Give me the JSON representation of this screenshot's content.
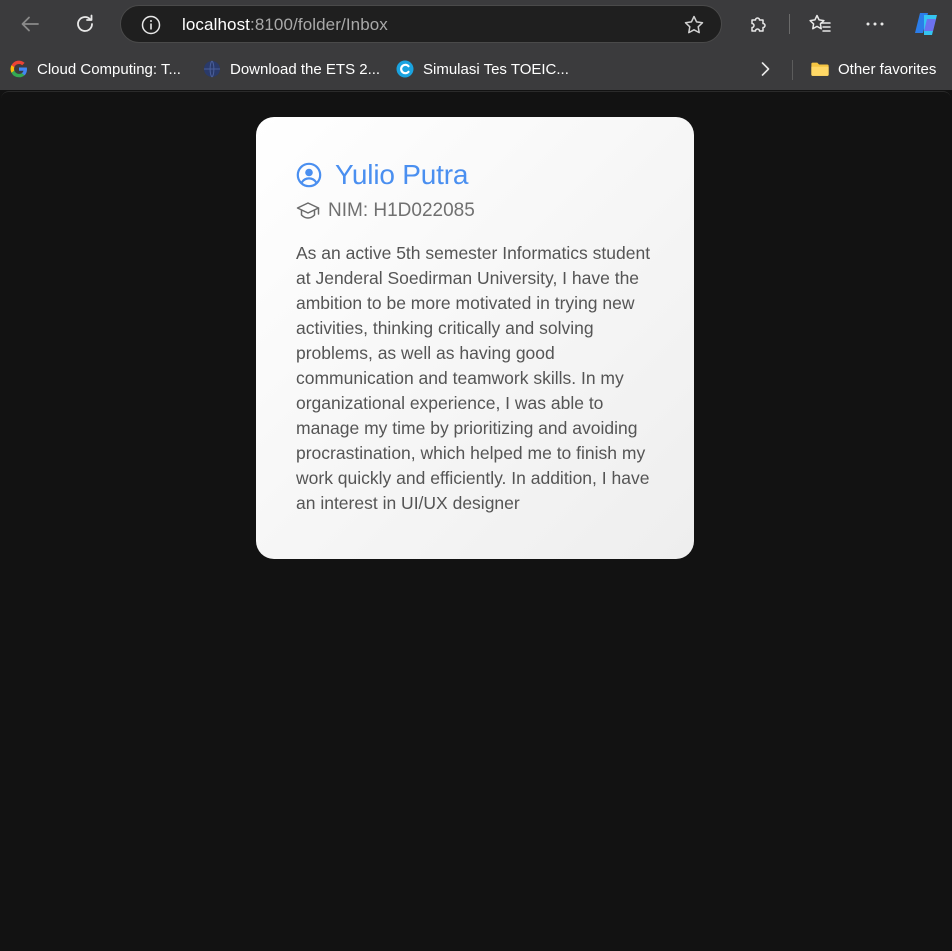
{
  "browser": {
    "url_host": "localhost",
    "url_path": ":8100/folder/Inbox",
    "bookmarks": [
      {
        "label": "Cloud Computing: T...",
        "icon": "google-icon"
      },
      {
        "label": "Download the ETS 2...",
        "icon": "globe-icon"
      },
      {
        "label": "Simulasi Tes TOEIC...",
        "icon": "site-c-icon"
      }
    ],
    "other_favorites": "Other favorites"
  },
  "card": {
    "name": "Yulio Putra",
    "nim": "NIM: H1D022085",
    "description": "As an active 5th semester Informatics student at Jenderal Soedirman University, I have the ambition to be more motivated in trying new activities, thinking critically and solving problems, as well as having good communication and teamwork skills. In my organizational experience, I was able to manage my time by prioritizing and avoiding procrastination, which helped me to finish my work quickly and efficiently. In addition, I have an interest in UI/UX designer"
  },
  "colors": {
    "accent": "#4a8ff0",
    "chrome": "#3b3b3d",
    "page_background": "#121212"
  }
}
